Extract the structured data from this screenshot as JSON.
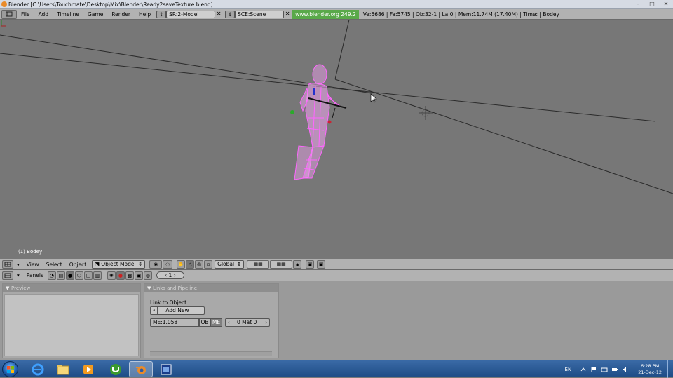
{
  "window": {
    "title": "Blender [C:\\Users\\Touchmate\\Desktop\\Mix\\Blender\\Ready2saveTexture.blend]",
    "min_glyph": "–",
    "max_glyph": "□",
    "close_glyph": "✕"
  },
  "topmenu": {
    "items": [
      "File",
      "Add",
      "Timeline",
      "Game",
      "Render",
      "Help"
    ],
    "screen_field": "SR:2-Model",
    "scene_field": "SCE:Scene",
    "link": "www.blender.org 249.2",
    "stats": "Ve:5686 | Fa:5745 | Ob:32-1 | La:0 | Mem:11.74M (17.40M) | Time: | Bodey"
  },
  "viewport": {
    "object_label": "(1) Bodey",
    "wire_color": "#ff66ff",
    "bg_color": "#777777"
  },
  "viewheader": {
    "menus": [
      "View",
      "Select",
      "Object"
    ],
    "mode": "Object Mode",
    "orientation": "Global"
  },
  "buttonsheader": {
    "panels_label": "Panels",
    "frame": "1"
  },
  "panels": {
    "preview_title": "Preview",
    "links_title": "Links and Pipeline",
    "link_to_object": "Link to Object",
    "add_new": "Add New",
    "me_field": "ME:1.058",
    "ob_label": "OB",
    "me_label": "ME",
    "mat_field": "0 Mat 0"
  },
  "taskbar": {
    "language": "EN",
    "time": "6:28 PM",
    "date": "21-Dec-12"
  }
}
